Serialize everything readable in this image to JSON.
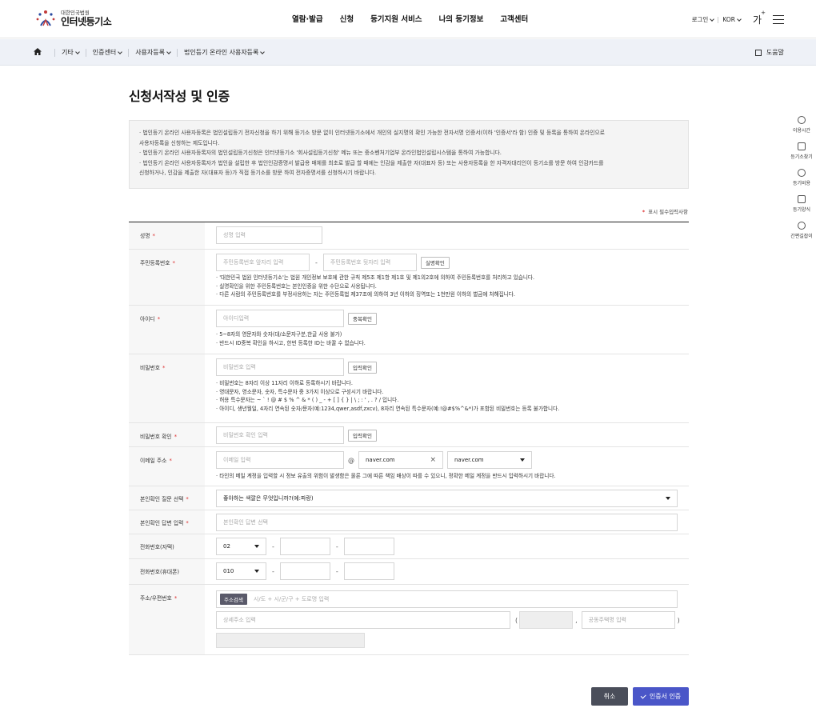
{
  "header": {
    "logo_sub": "대한민국법원",
    "logo_main": "인터넷등기소",
    "gnb": [
      "열람·발급",
      "신청",
      "등기지원 서비스",
      "나의 등기정보",
      "고객센터"
    ],
    "login": "로그인",
    "lang": "KOR",
    "font_size": "가",
    "font_plus": "+"
  },
  "breadcrumb": {
    "items": [
      "기타",
      "인증센터",
      "사용자등록",
      "법인등기 온라인 사용자등록"
    ],
    "help": "도움말"
  },
  "page": {
    "title": "신청서작성 및 인증",
    "notices": [
      "· 법인등기 온라인 사용자등록은 법인설립등기 전자신청을 하기 위해 등기소 방문 없이 인터넷등기소에서 개인의 실지명의 확인 가능한 전자서명 인증서(이하 '인증서'라 함) 인증 및 등록을 통하여 온라인으로",
      "사용자등록을 신청하는 제도입니다.",
      "· 법인등기 온라인 사용자등록자의 법인설립등기신청은 인터넷등기소 '회사설립등기신청' 메뉴 또는 중소벤처기업부 온라인법인설립시스템을 통하여 가능합니다.",
      "· 법인등기 온라인 사용자등록자가 법인을 설립한 후 법인인감증명서 발급용 매체를 최초로 발급 할 때에는 인감을 제출한 자(대표자 등) 또는 사용자등록을 한 자격자대리인이 등기소를 방문 하여 인감카드를",
      "신청하거나, 인감을 제출한 자(대표자 등)가 직접 등기소를 방문 하여 전자증명서를 신청하시기 바랍니다."
    ],
    "required_star": "*",
    "required_note": "표시 필수입력사항"
  },
  "form": {
    "name": {
      "label": "성명",
      "placeholder": "성명 입력"
    },
    "rrn": {
      "label": "주민등록번호",
      "ph1": "주민등록번호 앞자리 입력",
      "ph2": "주민등록번호 뒷자리 입력",
      "dash": "-",
      "button": "실명확인",
      "desc": [
        "· '대한민국 법원 인터넷등기소'는 법원 개인정보 보호에 관한 규칙 제5조 제1항 제1호 및 제1의2호에 의하여 주민등록번호를 처리하고 있습니다.",
        "· 실명확인을 위한 주민등록번호는 본인인증을 위한 수단으로 사용됩니다.",
        "· 다른 사람의 주민등록번호를 부정사용하는 자는 주민등록법 제37조에 의하여 3년 이하의 징역또는 1천만원 이하의 벌금에 처해집니다."
      ]
    },
    "id": {
      "label": "아이디",
      "placeholder": "아이디입력",
      "button": "중복확인",
      "desc": [
        "· 5~8자의 영문자와 숫자(대/소문자구분,한글 사용 불가)",
        "· 반드시 ID중복 확인을 하시고, 한번 등록한 ID는 바꿀 수 없습니다."
      ]
    },
    "password": {
      "label": "비밀번호",
      "placeholder": "비밀번호 입력",
      "button": "입력확인",
      "desc": [
        "· 비밀번호는 8자리 이상 11자리 이하로 등록하시기 바랍니다.",
        "· 영대문자, 영소문자, 숫자, 특수문자 중 3가지 이상으로 구성시기 바랍니다.",
        "· 허용 특수문자는 ~ ` ! @ # $ % ^ & * ( ) _ - + [ ] { } | \\ ; : ' , . ? / 입니다.",
        "· 아이디, 생년월일, 4자리 연속된 숫자/문자(예:1234,qwer,asdf,zxcv), 8자리 연속된 특수문자(예:!@#$%^&*)가 포함된 비밀번호는 등록 불가합니다."
      ]
    },
    "password_confirm": {
      "label": "비밀번호 확인",
      "placeholder": "비밀번호 확인 입력",
      "button": "입력확인"
    },
    "email": {
      "label": "이메일 주소",
      "placeholder": "이메일 입력",
      "at": "@",
      "domain_value": "naver.com",
      "clear": "×",
      "select_value": "naver.com",
      "desc": "· 타인의 메일 계정을 입력할 시 정보 유출의 위험이 발생함은 물론 그에 따른 책임 배상이 따를 수 있으니, 정확한 메일 계정을 반드시 입력하시기 바랍니다."
    },
    "question": {
      "label": "본인확인 질문 선택",
      "value": "좋아하는 색깔은 무엇입니까?(예:파랑)"
    },
    "answer": {
      "label": "본인확인 답변 입력",
      "placeholder": "본인확인 답변 선택"
    },
    "phone": {
      "label": "전화번호(자택)",
      "prefix": "02",
      "dash": "-"
    },
    "mobile": {
      "label": "전화번호(휴대폰)",
      "prefix": "010",
      "dash": "-"
    },
    "address": {
      "label": "주소/우편번호",
      "button": "주소검색",
      "placeholder1": "시/도 + 시/군/구 + 도로명 입력",
      "placeholder2": "상세주소 입력",
      "paren_open": "(",
      "comma": ",",
      "placeholder3": "공동주택명 입력",
      "paren_close": ")"
    }
  },
  "sidebar": [
    "이용시간",
    "등기소찾기",
    "등기비용",
    "등기양식",
    "간편길잡이"
  ],
  "actions": {
    "cancel": "취소",
    "submit": "인증서 인증"
  }
}
